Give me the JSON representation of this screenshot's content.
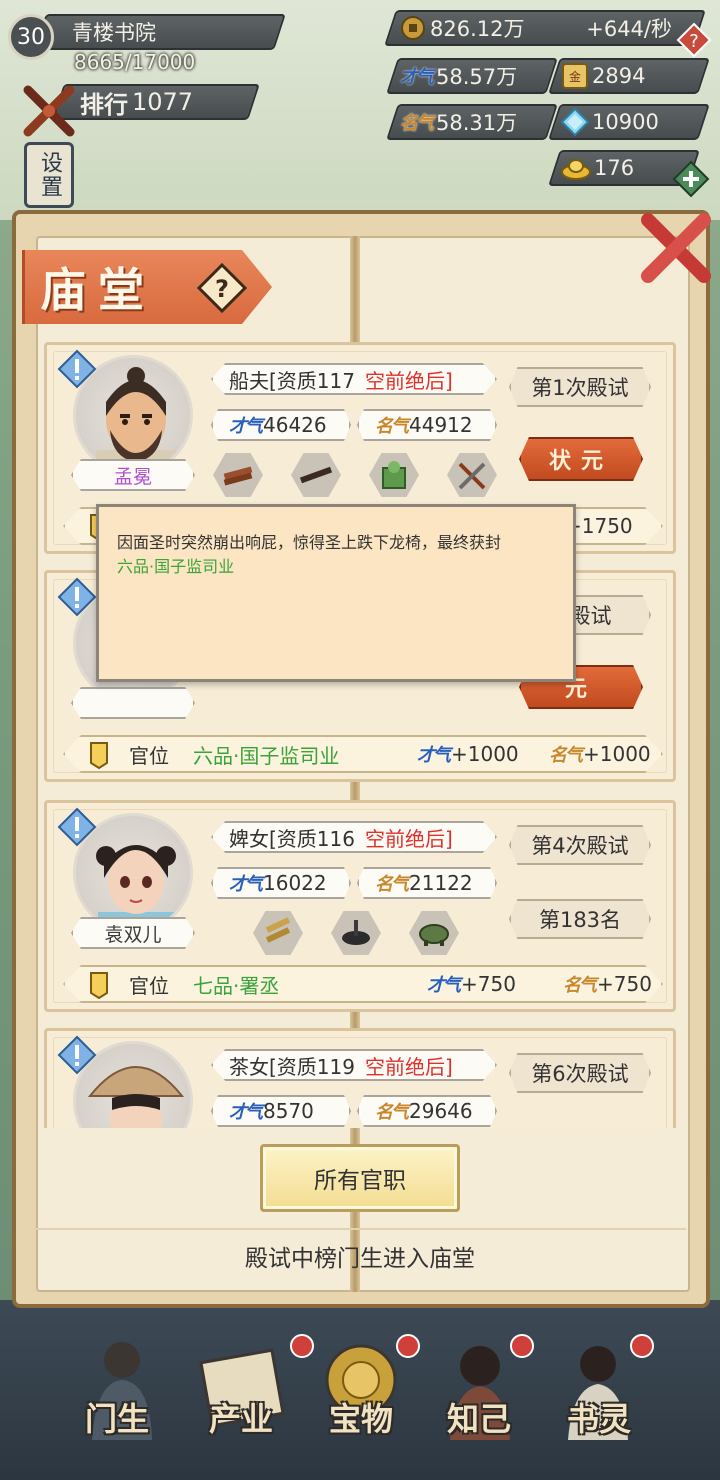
{
  "player": {
    "level": "30",
    "academy": "青楼书院",
    "exp": "8665/17000",
    "rank_label": "排行",
    "rank_value": "1077",
    "settings": "设置"
  },
  "resources": {
    "coins": "826.12万",
    "coins_rate": "+644/秒",
    "talent": "58.57万",
    "fame": "58.31万",
    "item_a": "2894",
    "diamond": "10900",
    "gold_ingot": "176"
  },
  "panel": {
    "title": "庙堂",
    "all_offices_button": "所有官职",
    "footer_note": "殿试中榜门生进入庙堂",
    "office_label": "官位"
  },
  "students": [
    {
      "name": "孟冕",
      "identity": "船夫[资质117",
      "quality": "空前绝后]",
      "exam": "第1次殿试",
      "result": "状元",
      "talent": "46426",
      "fame": "44912",
      "bonus_fame": "+1750"
    },
    {
      "name": "",
      "exam": "次殿试",
      "result": "元",
      "office": "六品·国子监司业",
      "talent_bonus": "+1000",
      "fame_bonus": "+1000"
    },
    {
      "name": "袁双儿",
      "identity": "婢女[资质116",
      "quality": "空前绝后]",
      "exam": "第4次殿试",
      "result": "第183名",
      "talent": "16022",
      "fame": "21122",
      "office": "七品·署丞",
      "talent_bonus": "+750",
      "fame_bonus": "+750"
    },
    {
      "name": "",
      "identity": "茶女[资质119",
      "quality": "空前绝后]",
      "exam": "第6次殿试",
      "talent": "8570",
      "fame": "29646"
    }
  ],
  "tooltip": {
    "text": "因面圣时突然崩出响屁，惊得圣上跌下龙椅，最终获封",
    "office": "六品·国子监司业"
  },
  "nav": [
    {
      "label": "门生"
    },
    {
      "label": "产业"
    },
    {
      "label": "宝物"
    },
    {
      "label": "知己"
    },
    {
      "label": "书灵"
    }
  ],
  "colors": {
    "accent_orange": "#d86a3f",
    "quality_red": "#e0302c",
    "office_green": "#3aa33a",
    "talent_blue": "#2a5fb8",
    "fame_gold": "#c8882a"
  }
}
